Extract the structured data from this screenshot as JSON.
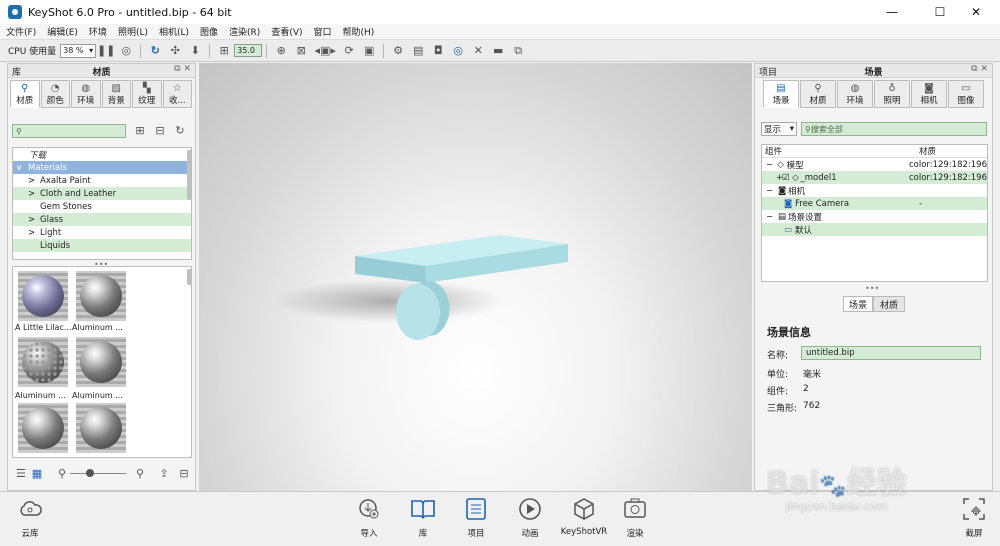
{
  "window": {
    "title": "KeyShot 6.0 Pro  - untitled.bip  - 64 bit",
    "minimize": "—",
    "maximize": "☐",
    "close": "✕"
  },
  "menu": [
    "文件(F)",
    "编辑(E)",
    "环境",
    "照明(L)",
    "相机(L)",
    "图像",
    "渲染(R)",
    "查看(V)",
    "窗口",
    "帮助(H)"
  ],
  "toolbar": {
    "cpu_label": "CPU 使用量",
    "cpu_value": "38 %",
    "fov_value": "35.0"
  },
  "library": {
    "header_left": "库",
    "title": "材质",
    "tabs": [
      "材质",
      "颜色",
      "环境",
      "背景",
      "纹理",
      "收..."
    ],
    "search_placeholder": "",
    "tree": [
      {
        "label": "下载",
        "italic": true
      },
      {
        "label": "Materials",
        "expand": "∨",
        "selected": true
      },
      {
        "label": "Axalta Paint",
        "expand": ">"
      },
      {
        "label": "Cloth and Leather",
        "expand": ">"
      },
      {
        "label": "Gem Stones",
        "expand": ""
      },
      {
        "label": "Glass",
        "expand": ">"
      },
      {
        "label": "Light",
        "expand": ">"
      },
      {
        "label": "Liquids",
        "expand": ""
      }
    ],
    "thumbs": [
      {
        "label": "A Little Lilac...",
        "tone": "lilac"
      },
      {
        "label": "Aluminum ...",
        "tone": "metal"
      },
      {
        "label": "Aluminum ...",
        "tone": "perforated"
      },
      {
        "label": "Aluminum ...",
        "tone": "metal"
      },
      {
        "label": "Alumi...",
        "tone": "metal"
      },
      {
        "label": "Alumi...",
        "tone": "metal"
      }
    ]
  },
  "project": {
    "header_left": "项目",
    "title": "场景",
    "tabs": [
      "场景",
      "材质",
      "环境",
      "照明",
      "相机",
      "图像"
    ],
    "show_label": "显示",
    "search_placeholder": "搜索全部",
    "col_component": "组件",
    "col_material": "材质",
    "tree": [
      {
        "label": "模型",
        "material": "color:129:182:196",
        "indent": 0,
        "green": false
      },
      {
        "label": "_model1",
        "material": "color:129:182:196",
        "indent": 1,
        "green": true
      },
      {
        "label": "相机",
        "material": "",
        "indent": 0,
        "green": false
      },
      {
        "label": "Free Camera",
        "material": "-",
        "indent": 1,
        "green": true
      },
      {
        "label": "场景设置",
        "material": "",
        "indent": 0,
        "green": false
      },
      {
        "label": "默认",
        "material": "",
        "indent": 1,
        "green": true
      }
    ],
    "subtabs": [
      "场景",
      "材质"
    ],
    "info": {
      "title": "场景信息",
      "name_label": "名称:",
      "name_value": "untitled.bip",
      "unit_label": "单位:",
      "unit_value": "毫米",
      "comp_label": "组件:",
      "comp_value": "2",
      "tri_label": "三角形:",
      "tri_value": "762"
    }
  },
  "model_color": "#81b6c4",
  "bottom": {
    "cloud": "云库",
    "items": [
      "导入",
      "库",
      "项目",
      "动画",
      "KeyShotVR",
      "渲染"
    ],
    "screenshot": "截屏"
  },
  "watermark": {
    "brand": "Bai",
    "brand_cn": "经验",
    "url": "jingyan.baidu.com"
  }
}
